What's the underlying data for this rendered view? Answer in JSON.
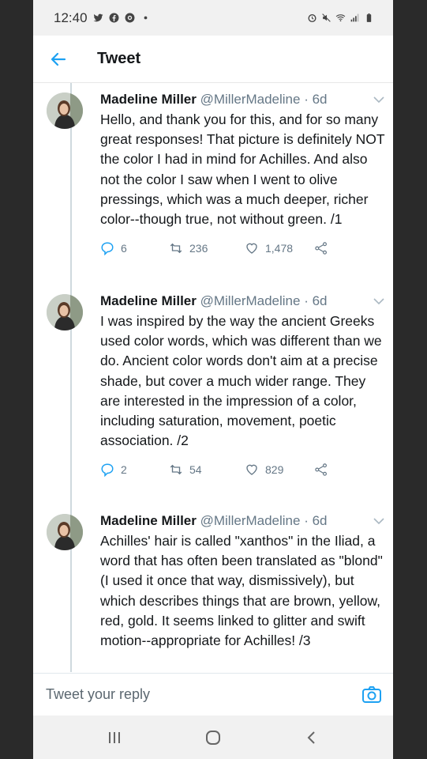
{
  "status_bar": {
    "time": "12:40",
    "left_icons": [
      "twitter-icon",
      "facebook-icon",
      "messenger-icon",
      "notification-dot-icon"
    ],
    "right_icons": [
      "alarm-icon",
      "mute-icon",
      "wifi-icon",
      "signal-icon",
      "battery-icon"
    ]
  },
  "app_bar": {
    "title": "Tweet",
    "back_icon": "back-arrow-icon"
  },
  "colors": {
    "accent": "#1da1f2",
    "text": "#14171a",
    "secondary": "#657786",
    "thread_line": "#cfd9de"
  },
  "tweets": [
    {
      "name": "Madeline Miller",
      "handle": "@MillerMadeline",
      "time": " · 6d",
      "text": "Hello, and thank you for this, and for so many great responses! That picture is definitely NOT the color I had in mind for Achilles. And also not the color I saw when I went to olive pressings, which was a much deeper, richer color--though true, not without green. /1",
      "replies": "6",
      "retweets": "236",
      "likes": "1,478"
    },
    {
      "name": "Madeline Miller",
      "handle": "@MillerMadeline",
      "time": " · 6d",
      "text": "I was inspired by the way the ancient Greeks used color words, which was different than we do. Ancient color words don't aim at a precise shade, but cover a much wider range. They are interested in the impression of a color, including saturation, movement, poetic association. /2",
      "replies": "2",
      "retweets": "54",
      "likes": "829"
    },
    {
      "name": "Madeline Miller",
      "handle": "@MillerMadeline",
      "time": " · 6d",
      "text": "Achilles' hair is called \"xanthos\" in the Iliad, a word that has often been translated as \"blond\" (I used it once that way, dismissively), but which describes things that are brown, yellow, red, gold. It seems linked to glitter and swift motion--appropriate for Achilles! /3",
      "replies": "",
      "retweets": "",
      "likes": ""
    }
  ],
  "reply_bar": {
    "placeholder": "Tweet your reply",
    "camera_icon": "camera-icon"
  },
  "nav_bar": {
    "icons": [
      "recents-icon",
      "home-icon",
      "back-icon"
    ]
  }
}
